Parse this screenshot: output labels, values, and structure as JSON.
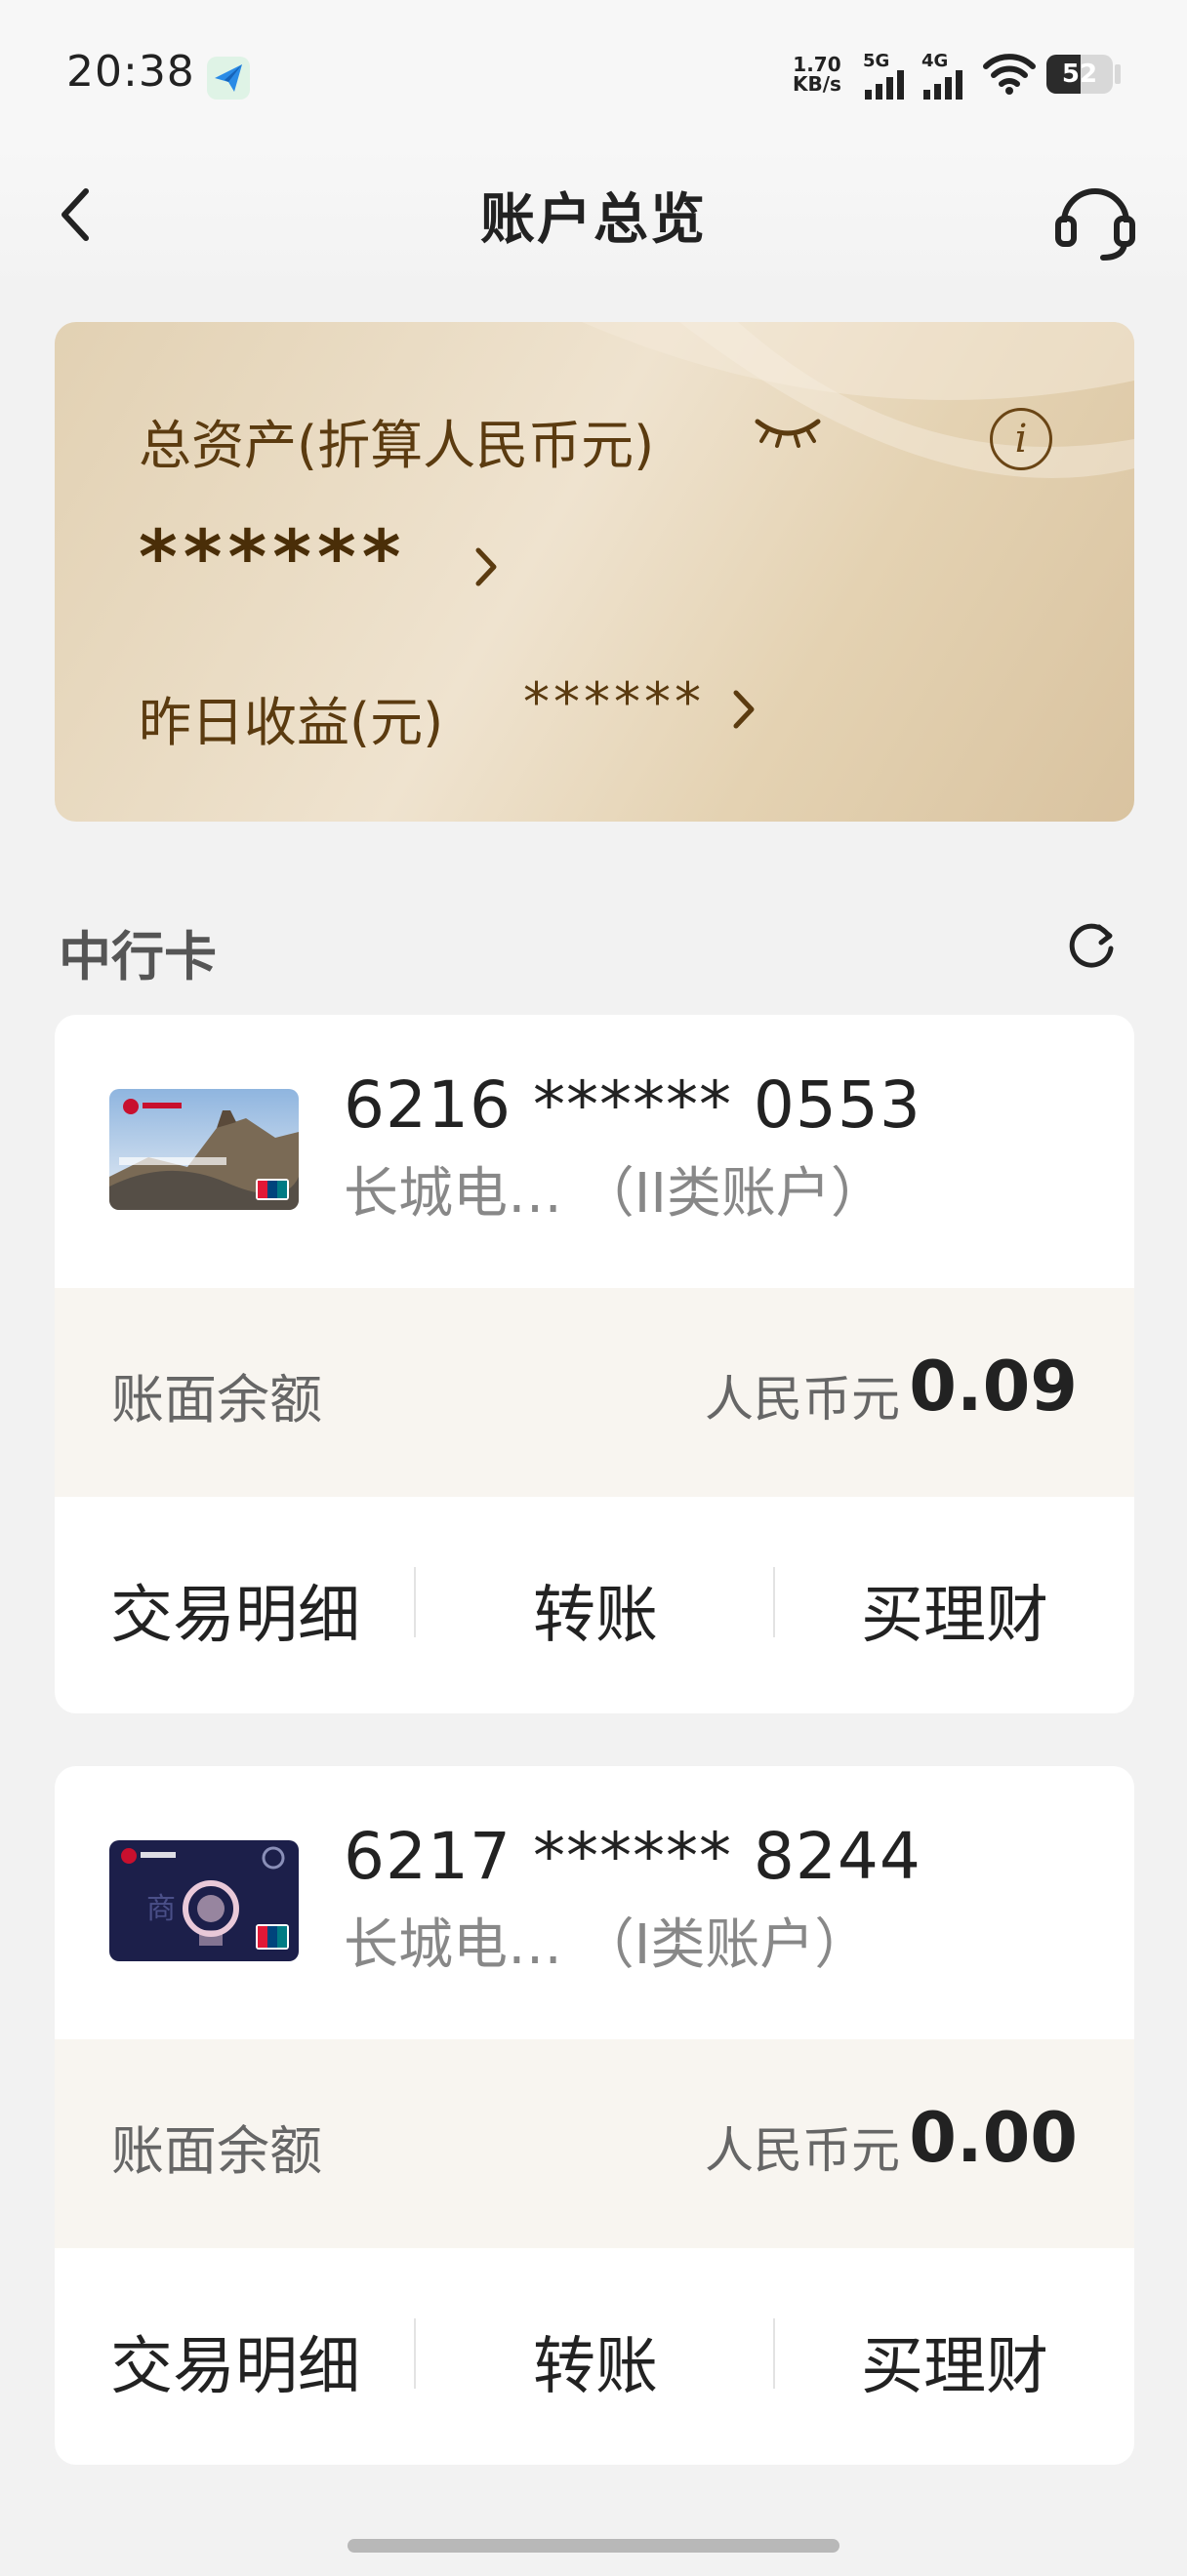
{
  "status_bar": {
    "time": "20:38",
    "net_speed_value": "1.70",
    "net_speed_unit": "KB/s",
    "signal_1": "5G",
    "signal_2": "4G",
    "battery": "52",
    "battery_level": 0.52,
    "app_icon": "paper-plane-icon"
  },
  "nav": {
    "title": "账户总览",
    "back_icon": "back-chevron-icon",
    "service_icon": "headset-icon"
  },
  "asset_card": {
    "title": "总资产(折算人民币元)",
    "masked_total": "******",
    "yesterday_label": "昨日收益(元)",
    "yesterday_value": "******",
    "info_glyph": "i"
  },
  "section": {
    "title": "中行卡"
  },
  "accounts": [
    {
      "card_number": "6216 ****** 0553",
      "description": "长城电… （II类账户）",
      "balance_label": "账面余额",
      "currency": "人民币元",
      "balance": "0.09",
      "actions": [
        "交易明细",
        "转账",
        "买理财"
      ]
    },
    {
      "card_number": "6217 ****** 8244",
      "description": "长城电… （I类账户）",
      "balance_label": "账面余额",
      "currency": "人民币元",
      "balance": "0.00",
      "actions": [
        "交易明细",
        "转账",
        "买理财"
      ]
    }
  ],
  "colors": {
    "gold_text": "#5b3b10",
    "card_bg": "#e8d9bf",
    "page_bg": "#f2f2f2"
  }
}
